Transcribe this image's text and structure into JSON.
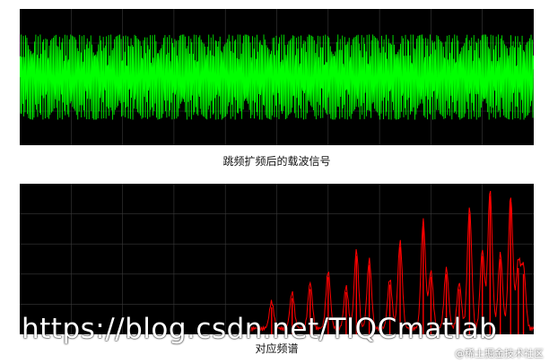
{
  "colors": {
    "carrier": "#00ff00",
    "spectrum": "#ff0000",
    "background": "#000000",
    "grid": "#3a3a3a"
  },
  "captions": {
    "top": "跳频扩频后的载波信号",
    "bottom": "对应频谱"
  },
  "watermark": {
    "url": "https://blog.csdn.net/TIQCmatlab",
    "site": "@稀土掘金技术社区"
  },
  "chart_data": [
    {
      "type": "line",
      "title": "跳频扩频后的载波信号",
      "grid": true,
      "ylim": [
        -1.6,
        1.6
      ],
      "series": [
        {
          "color": "#00ff00",
          "amplitude": 1
        }
      ]
    },
    {
      "type": "line",
      "title": "对应频谱",
      "grid": true,
      "xlim": [
        0,
        1
      ],
      "ylim": [
        0,
        1
      ],
      "series": [
        {
          "color": "#ff0000",
          "peaks": [
            {
              "x": 0.49,
              "y": 0.18
            },
            {
              "x": 0.53,
              "y": 0.24
            },
            {
              "x": 0.565,
              "y": 0.3
            },
            {
              "x": 0.6,
              "y": 0.38
            },
            {
              "x": 0.635,
              "y": 0.28
            },
            {
              "x": 0.655,
              "y": 0.52
            },
            {
              "x": 0.68,
              "y": 0.46
            },
            {
              "x": 0.72,
              "y": 0.33
            },
            {
              "x": 0.74,
              "y": 0.58
            },
            {
              "x": 0.785,
              "y": 0.72
            },
            {
              "x": 0.8,
              "y": 0.38
            },
            {
              "x": 0.83,
              "y": 0.4
            },
            {
              "x": 0.855,
              "y": 0.3
            },
            {
              "x": 0.875,
              "y": 0.8
            },
            {
              "x": 0.9,
              "y": 0.52
            },
            {
              "x": 0.915,
              "y": 0.92
            },
            {
              "x": 0.935,
              "y": 0.5
            },
            {
              "x": 0.955,
              "y": 0.88
            },
            {
              "x": 0.97,
              "y": 0.44
            },
            {
              "x": 0.98,
              "y": 0.4
            }
          ]
        }
      ]
    }
  ]
}
